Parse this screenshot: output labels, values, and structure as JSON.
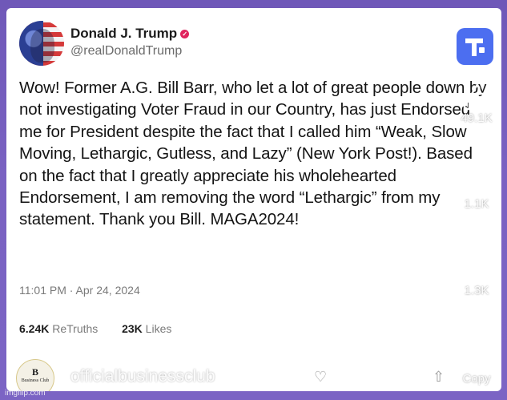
{
  "post": {
    "author_name": "Donald J. Trump",
    "handle": "@realDonaldTrump",
    "text": "Wow! Former A.G. Bill Barr, who let a lot of great people down by not investigating Voter Fraud in our Country, has just Endorsed me for President despite the fact that I called him “Weak, Slow Moving, Lethargic, Gutless, and Lazy” (New York Post!). Based on the fact that I greatly appreciate his wholehearted Endorsement, I am removing the word “Lethargic” from my statement. Thank you Bill. MAGA2024!",
    "timestamp": "11:01 PM · Apr 24, 2024",
    "retruths_count": "6.24K",
    "retruths_label": "ReTruths",
    "likes_count": "23K",
    "likes_label": "Likes"
  },
  "overlay": {
    "account_name": "officialbusinessclub",
    "badge_letter": "B",
    "badge_text": "Business Club",
    "like_count": "49.1K",
    "comment_count": "1.1K",
    "share_count": "1.3K",
    "copy_label": "Copy"
  },
  "watermark": "imgflip.com",
  "colors": {
    "background": "#7a62c2",
    "truth_social_blue": "#4c6ef0",
    "verified_red": "#e0245e"
  },
  "icons": [
    "truth-social-logo-icon",
    "verified-badge-icon",
    "like-icon",
    "comment-icon",
    "share-icon",
    "copy-link-icon",
    "heart-icon",
    "instagram-icon"
  ]
}
